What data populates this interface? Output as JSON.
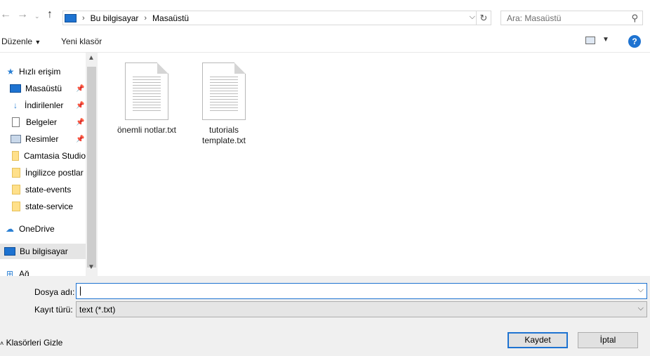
{
  "address": {
    "crumbs": [
      "Bu bilgisayar",
      "Masaüstü"
    ]
  },
  "search": {
    "placeholder": "Ara: Masaüstü"
  },
  "toolbar": {
    "organize": "Düzenle",
    "new_folder": "Yeni klasör",
    "help": "?"
  },
  "nav": {
    "quick_access": "Hızlı erişim",
    "items": [
      {
        "label": "Masaüstü",
        "icon": "desktop-icon",
        "pinned": true
      },
      {
        "label": "İndirilenler",
        "icon": "download-icon",
        "pinned": true
      },
      {
        "label": "Belgeler",
        "icon": "documents-icon",
        "pinned": true
      },
      {
        "label": "Resimler",
        "icon": "pictures-icon",
        "pinned": true
      },
      {
        "label": "Camtasia Studio",
        "icon": "folder-icon",
        "pinned": false
      },
      {
        "label": "İngilizce postlar",
        "icon": "folder-icon",
        "pinned": false
      },
      {
        "label": "state-events",
        "icon": "folder-icon",
        "pinned": false
      },
      {
        "label": "state-service",
        "icon": "folder-icon",
        "pinned": false
      }
    ],
    "onedrive": "OneDrive",
    "this_pc": "Bu bilgisayar",
    "network": "Ağ"
  },
  "files": [
    {
      "name": "önemli notlar.txt"
    },
    {
      "name": "tutorials template.txt"
    }
  ],
  "form": {
    "filename_label": "Dosya adı:",
    "filename_value": "",
    "filetype_label": "Kayıt türü:",
    "filetype_value": "text (*.txt)"
  },
  "buttons": {
    "save": "Kaydet",
    "cancel": "İptal",
    "hide_folders": "Klasörleri Gizle"
  },
  "colors": {
    "accent": "#1e73d1",
    "selection": "#e5e5e5"
  }
}
